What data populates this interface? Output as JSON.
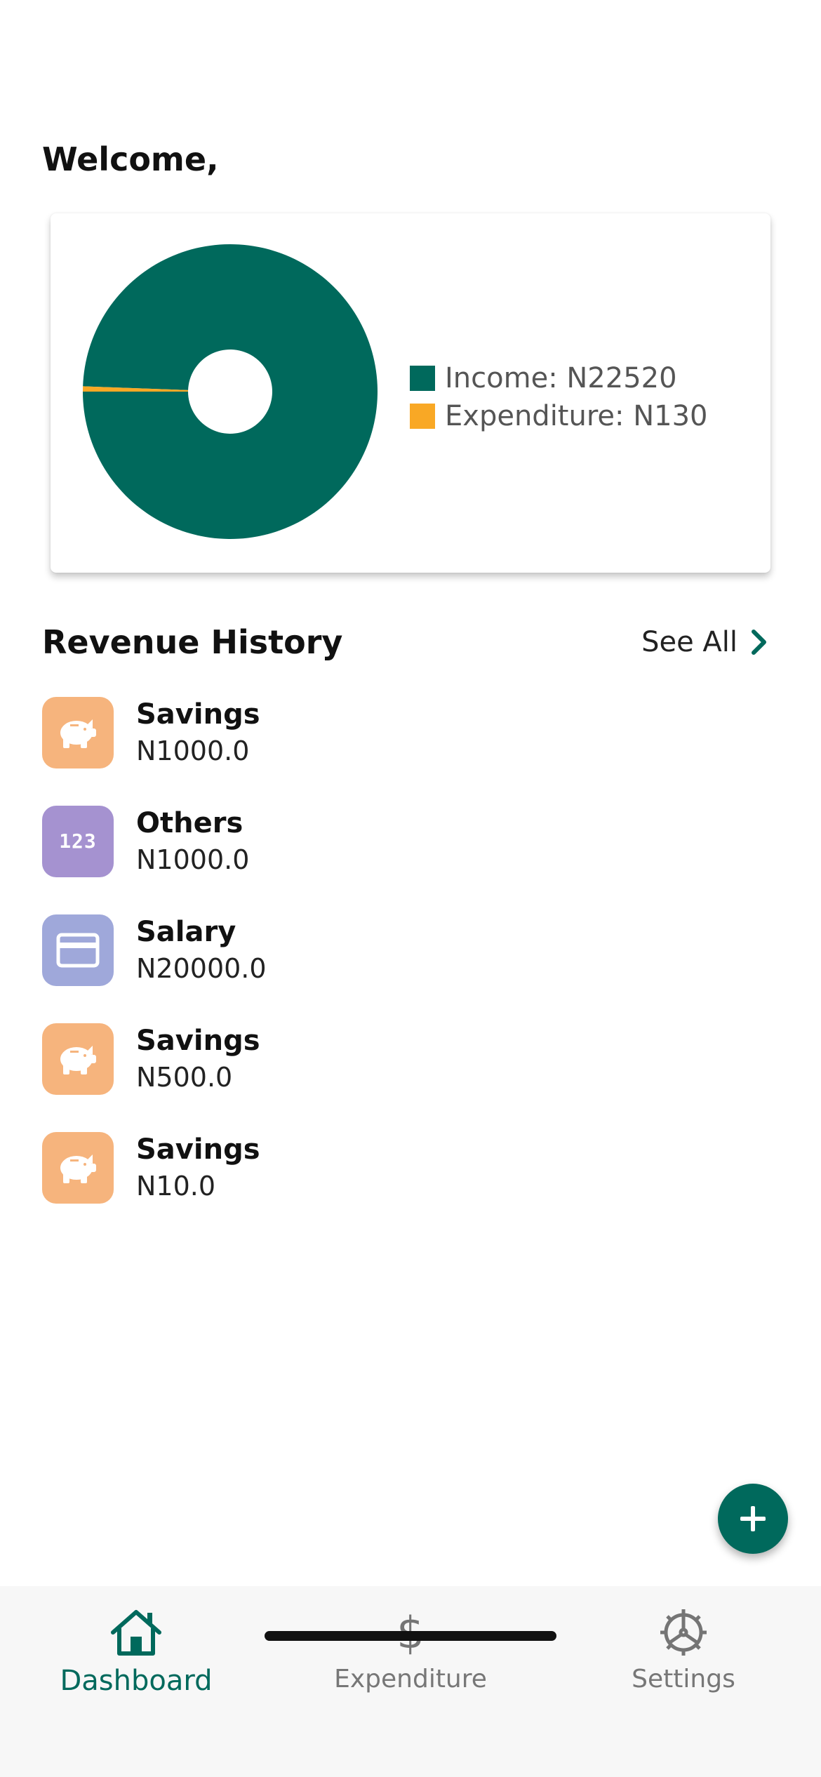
{
  "header": {
    "welcome": "Welcome,"
  },
  "chart_data": {
    "type": "pie",
    "style": "donut",
    "categories": [
      "Income",
      "Expenditure"
    ],
    "values": [
      22520,
      130
    ],
    "colors": [
      "#00695c",
      "#f9a825"
    ],
    "legend": [
      "Income: N22520",
      "Expenditure: N130"
    ],
    "legend_position": "right"
  },
  "revenue": {
    "title": "Revenue History",
    "see_all": "See All",
    "items": [
      {
        "title": "Savings",
        "amount": "N1000.0",
        "icon": "piggy-bank-icon",
        "color": "#f6b47d"
      },
      {
        "title": "Others",
        "amount": "N1000.0",
        "icon": "numbers-icon",
        "glyph": "123",
        "color": "#a592d0"
      },
      {
        "title": "Salary",
        "amount": "N20000.0",
        "icon": "credit-card-icon",
        "color": "#9fa8da"
      },
      {
        "title": "Savings",
        "amount": "N500.0",
        "icon": "piggy-bank-icon",
        "color": "#f6b47d"
      },
      {
        "title": "Savings",
        "amount": "N10.0",
        "icon": "piggy-bank-icon",
        "color": "#f6b47d"
      }
    ]
  },
  "nav": {
    "items": [
      {
        "label": "Dashboard",
        "icon": "home-icon",
        "active": true
      },
      {
        "label": "Expenditure",
        "icon": "dollar-icon",
        "glyph": "$",
        "active": false
      },
      {
        "label": "Settings",
        "icon": "gear-icon",
        "active": false
      }
    ]
  },
  "colors": {
    "primary": "#00695c",
    "accent": "#f9a825"
  }
}
